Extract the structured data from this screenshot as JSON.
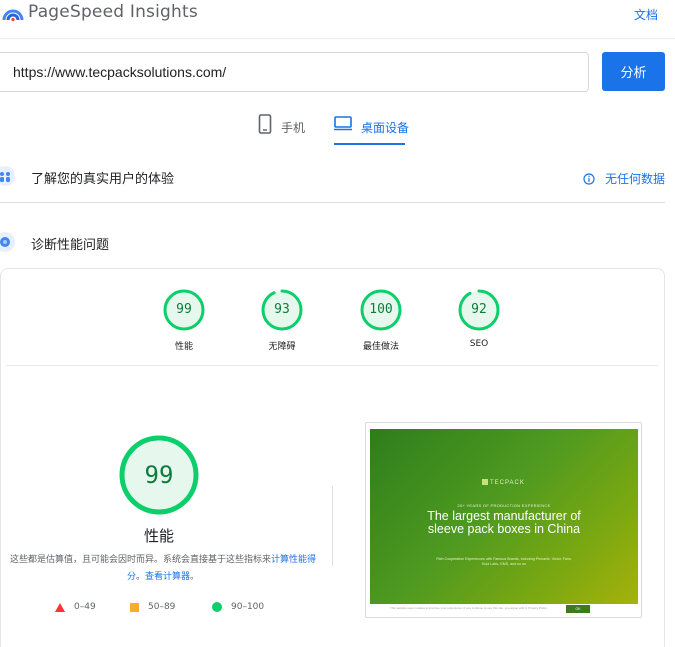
{
  "header": {
    "brand": "PageSpeed Insights",
    "docs_label": "文档"
  },
  "search": {
    "url_value": "https://www.tecpacksolutions.com/",
    "analyze_label": "分析"
  },
  "tabs": [
    {
      "label": "手机",
      "icon": "mobile-icon",
      "active": false
    },
    {
      "label": "桌面设备",
      "icon": "desktop-icon",
      "active": true
    }
  ],
  "crux": {
    "title": "了解您的真实用户的体验",
    "no_data_label": "无任何数据",
    "icon": "people-icon"
  },
  "diagnose": {
    "title": "诊断性能问题",
    "icon": "lighthouse-icon"
  },
  "scores": [
    {
      "label": "性能",
      "value": 99
    },
    {
      "label": "无障碍",
      "value": 93
    },
    {
      "label": "最佳做法",
      "value": 100
    },
    {
      "label": "SEO",
      "value": 92
    }
  ],
  "performance": {
    "value": 99,
    "label": "性能",
    "note_text": "这些都是估算值，且可能会因时而异。系统会直接基于这些指标来",
    "note_link1": "计算性能得分",
    "note_sep": "。",
    "note_link2": "查看计算器",
    "note_end": "。"
  },
  "legend": [
    {
      "range": "0–49",
      "shape": "triangle",
      "color": "#ff3333"
    },
    {
      "range": "50–89",
      "shape": "square",
      "color": "#ffaa33"
    },
    {
      "range": "90–100",
      "shape": "circle",
      "color": "#0cce6b"
    }
  ],
  "screenshot": {
    "logo": "TECPACK",
    "kicker": "20+ YEARS OF PRODUCTION EXPERIENCE",
    "headline": "The largest manufacturer of sleeve pack boxes in China",
    "sub": "Rich Cooperation Experiences with Famous Brands, Including Pinnacle, Victor, Fans, Kula Labs, GMS, and so on",
    "cookie_text": "This website uses cookies to improve your experience. If you continue to use this site, you agree with it. Privacy Policy",
    "cookie_button": "OK"
  },
  "colors": {
    "accent": "#1a73e8",
    "pass": "#0cce6b",
    "pass_text": "#0d7c3a",
    "pass_bg": "#e6f8ee"
  }
}
